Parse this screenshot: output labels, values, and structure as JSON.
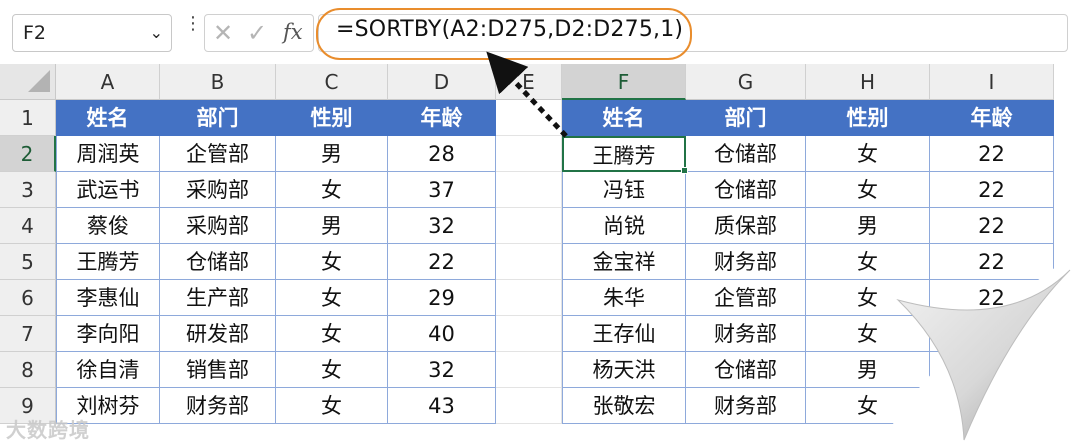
{
  "name_box": {
    "value": "F2",
    "dropdown_icon": "chevron-down-icon"
  },
  "formula_bar": {
    "cancel_icon": "close-icon",
    "enter_icon": "check-icon",
    "fx_label": "fx",
    "formula": "=SORTBY(A2:D275,D2:D275,1)"
  },
  "columns": [
    "A",
    "B",
    "C",
    "D",
    "E",
    "F",
    "G",
    "H",
    "I"
  ],
  "rows": [
    "1",
    "2",
    "3",
    "4",
    "5",
    "6",
    "7",
    "8",
    "9"
  ],
  "selected": {
    "column": "F",
    "row": "2"
  },
  "left_table": {
    "headers": [
      "姓名",
      "部门",
      "性别",
      "年龄"
    ],
    "rows": [
      [
        "周润英",
        "企管部",
        "男",
        "28"
      ],
      [
        "武运书",
        "采购部",
        "女",
        "37"
      ],
      [
        "蔡俊",
        "采购部",
        "男",
        "32"
      ],
      [
        "王腾芳",
        "仓储部",
        "女",
        "22"
      ],
      [
        "李惠仙",
        "生产部",
        "女",
        "29"
      ],
      [
        "李向阳",
        "研发部",
        "女",
        "40"
      ],
      [
        "徐自清",
        "销售部",
        "女",
        "32"
      ],
      [
        "刘树芬",
        "财务部",
        "女",
        "43"
      ]
    ]
  },
  "right_table": {
    "headers": [
      "姓名",
      "部门",
      "性别",
      "年龄"
    ],
    "rows": [
      [
        "王腾芳",
        "仓储部",
        "女",
        "22"
      ],
      [
        "冯钰",
        "仓储部",
        "女",
        "22"
      ],
      [
        "尚锐",
        "质保部",
        "男",
        "22"
      ],
      [
        "金宝祥",
        "财务部",
        "女",
        "22"
      ],
      [
        "朱华",
        "企管部",
        "女",
        "22"
      ],
      [
        "王存仙",
        "财务部",
        "女",
        ""
      ],
      [
        "杨天洪",
        "仓储部",
        "男",
        ""
      ],
      [
        "张敬宏",
        "财务部",
        "女",
        ""
      ]
    ]
  },
  "watermark": "大数跨境",
  "colors": {
    "header_fill": "#4472c4",
    "highlight": "#e98d2d",
    "selection": "#217346"
  }
}
